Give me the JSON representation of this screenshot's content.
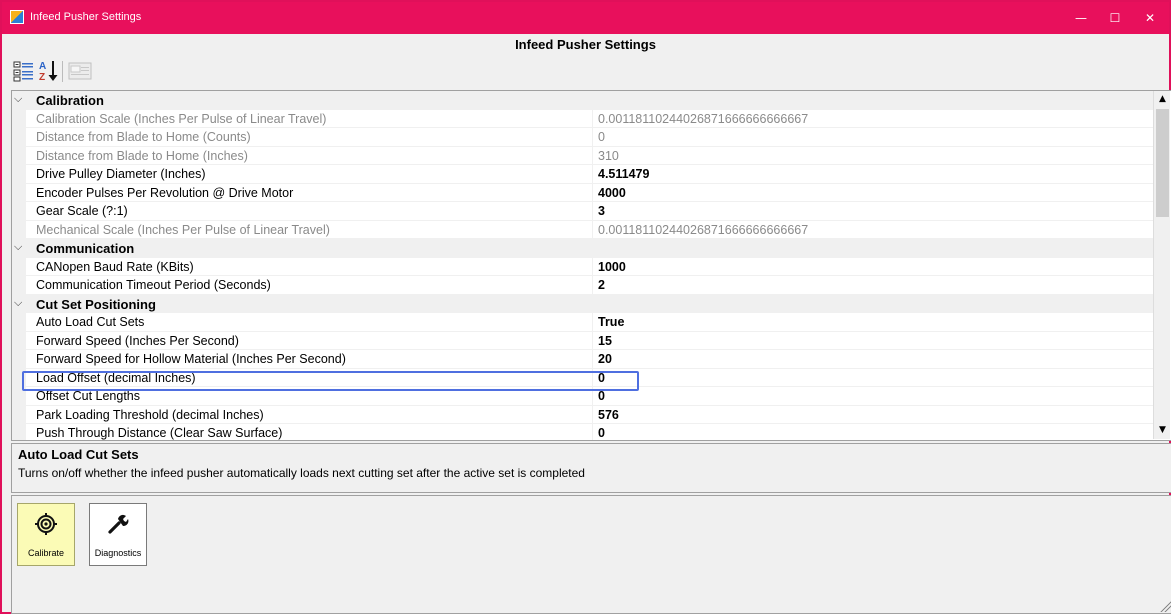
{
  "window": {
    "title": "Infeed Pusher Settings",
    "minimize_label": "—",
    "maximize_label": "☐",
    "close_label": "✕",
    "accent_color": "#e8105c"
  },
  "form": {
    "header": "Infeed Pusher Settings"
  },
  "toolbar": {
    "buttons": [
      {
        "name": "categorized-icon"
      },
      {
        "name": "alphabetical-sort-icon"
      },
      {
        "name": "property-pages-icon"
      }
    ]
  },
  "grid": {
    "categories": [
      {
        "label": "Calibration",
        "chevron": "⌵",
        "rows": [
          {
            "name": "Calibration Scale (Inches Per Pulse of Linear Travel)",
            "value": "0.00118110244026871666666666667",
            "readonly": true
          },
          {
            "name": "Distance from Blade to Home (Counts)",
            "value": "0",
            "readonly": true
          },
          {
            "name": "Distance from Blade to Home (Inches)",
            "value": "310",
            "readonly": true
          },
          {
            "name": "Drive Pulley Diameter (Inches)",
            "value": "4.511479",
            "readonly": false
          },
          {
            "name": "Encoder Pulses Per Revolution @ Drive Motor",
            "value": "4000",
            "readonly": false
          },
          {
            "name": "Gear Scale (?:1)",
            "value": "3",
            "readonly": false
          },
          {
            "name": "Mechanical Scale (Inches Per Pulse of Linear Travel)",
            "value": "0.00118110244026871666666666667",
            "readonly": true
          }
        ]
      },
      {
        "label": "Communication",
        "chevron": "⌵",
        "rows": [
          {
            "name": "CANopen Baud Rate (KBits)",
            "value": "1000",
            "readonly": false
          },
          {
            "name": "Communication Timeout Period (Seconds)",
            "value": "2",
            "readonly": false
          }
        ]
      },
      {
        "label": "Cut Set Positioning",
        "chevron": "⌵",
        "rows": [
          {
            "name": "Auto Load Cut Sets",
            "value": "True",
            "readonly": false
          },
          {
            "name": "Forward Speed (Inches Per Second)",
            "value": "15",
            "readonly": false
          },
          {
            "name": "Forward Speed for Hollow Material (Inches Per Second)",
            "value": "20",
            "readonly": false
          },
          {
            "name": "Load Offset (decimal Inches)",
            "value": "0",
            "readonly": false
          },
          {
            "name": "Offset Cut Lengths",
            "value": "0",
            "readonly": false
          },
          {
            "name": "Park Loading Threshold (decimal Inches)",
            "value": "576",
            "readonly": false
          },
          {
            "name": "Push Through Distance (Clear Saw Surface)",
            "value": "0",
            "readonly": false
          }
        ]
      }
    ],
    "highlight_color": "#4f6fe0"
  },
  "scrollbar": {
    "up_arrow": "▲",
    "down_arrow": "▼"
  },
  "help": {
    "title": "Auto Load Cut Sets",
    "description": "Turns on/off whether the infeed pusher automatically loads next cutting set after the active set is completed"
  },
  "actions": {
    "calibrate_label": "Calibrate",
    "diagnostics_label": "Diagnostics",
    "calibrate_bg": "#fbfbb6"
  }
}
